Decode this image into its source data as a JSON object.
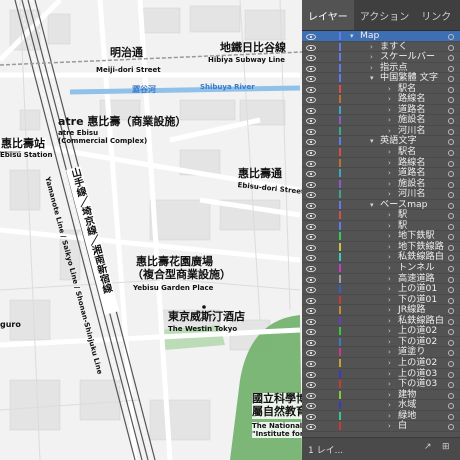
{
  "panel": {
    "tabs": [
      {
        "label": "レイヤー",
        "active": true
      },
      {
        "label": "アクション",
        "active": false
      },
      {
        "label": "リンク",
        "active": false
      }
    ],
    "footer": {
      "layer_count": "1 レイ..."
    },
    "layers": [
      {
        "name": "Map",
        "depth": 0,
        "color": "#5c7cf0",
        "selected": true
      },
      {
        "name": "ますく",
        "depth": 1,
        "color": "#5c7cf0"
      },
      {
        "name": "スケールバー",
        "depth": 1,
        "color": "#5c7cf0"
      },
      {
        "name": "指示点",
        "depth": 1,
        "color": "#5c7cf0"
      },
      {
        "name": "中国繁體 文字",
        "depth": 1,
        "color": "#5c7cf0"
      },
      {
        "name": "駅名",
        "depth": 2,
        "color": "#d94c4c"
      },
      {
        "name": "路線名",
        "depth": 2,
        "color": "#c07030"
      },
      {
        "name": "道路名",
        "depth": 2,
        "color": "#3aa8c8"
      },
      {
        "name": "施設名",
        "depth": 2,
        "color": "#8a5cc8"
      },
      {
        "name": "河川名",
        "depth": 2,
        "color": "#3aa88a"
      },
      {
        "name": "英語文字",
        "depth": 1,
        "color": "#5c7cf0"
      },
      {
        "name": "駅名",
        "depth": 2,
        "color": "#d94c4c"
      },
      {
        "name": "路線名",
        "depth": 2,
        "color": "#c07030"
      },
      {
        "name": "道路名",
        "depth": 2,
        "color": "#3aa8c8"
      },
      {
        "name": "施設名",
        "depth": 2,
        "color": "#8a5cc8"
      },
      {
        "name": "河川名",
        "depth": 2,
        "color": "#3aa88a"
      },
      {
        "name": "ベースmap",
        "depth": 1,
        "color": "#5c7cf0"
      },
      {
        "name": "駅",
        "depth": 2,
        "color": "#d94c4c"
      },
      {
        "name": "駅",
        "depth": 2,
        "color": "#5c7cf0"
      },
      {
        "name": "地下鉄駅",
        "depth": 2,
        "color": "#3ac85c"
      },
      {
        "name": "地下鉄線路",
        "depth": 2,
        "color": "#c8c83a"
      },
      {
        "name": "私鉄線路白",
        "depth": 2,
        "color": "#3ac8c8"
      },
      {
        "name": "トンネル",
        "depth": 2,
        "color": "#c83ac8"
      },
      {
        "name": "高速道路",
        "depth": 2,
        "color": "#a0a0a0"
      },
      {
        "name": "上の道01",
        "depth": 2,
        "color": "#3a5cc8"
      },
      {
        "name": "下の道01",
        "depth": 2,
        "color": "#c83a3a"
      },
      {
        "name": "JR線路",
        "depth": 2,
        "color": "#c8883a"
      },
      {
        "name": "私鉄線路白",
        "depth": 2,
        "color": "#6a3ac8"
      },
      {
        "name": "上の道02",
        "depth": 2,
        "color": "#3ac83a"
      },
      {
        "name": "下の道02",
        "depth": 2,
        "color": "#3a7ac8"
      },
      {
        "name": "道塗り",
        "depth": 2,
        "color": "#c83a8a"
      },
      {
        "name": "上の道02",
        "depth": 2,
        "color": "#c8a03a"
      },
      {
        "name": "上の道03",
        "depth": 2,
        "color": "#3a3ac8"
      },
      {
        "name": "下の道03",
        "depth": 2,
        "color": "#c83a3a"
      },
      {
        "name": "建物",
        "depth": 2,
        "color": "#8ac83a"
      },
      {
        "name": "水域",
        "depth": 2,
        "color": "#3a3ac8"
      },
      {
        "name": "緑地",
        "depth": 2,
        "color": "#3ac88a"
      },
      {
        "name": "白",
        "depth": 2,
        "color": "#c83a3a"
      }
    ]
  },
  "map": {
    "labels": {
      "meiji_jp": "明治通",
      "meiji_en": "Meiji-dori Street",
      "hibiya_jp": "地鐵日比谷線",
      "hibiya_en": "Hibiya Subway Line",
      "shibuya_river_jp": "澀谷河",
      "shibuya_river_en": "Shibuya River",
      "atre_jp": "atre 惠比壽（商業設施）",
      "atre_en1": "atre Ebisu",
      "atre_en2": "(Commercial Complex)",
      "ebisu_station_jp": "惠比壽站",
      "ebisu_station_en": "Ebisu Station",
      "ebisu_dori_jp": "惠比壽通",
      "ebisu_dori_en": "Ebisu-dori Street",
      "yamanote_jp": "山手線／埼京線／湘南新宿線",
      "yamanote_en": "Yamanote Line / Saikyo Line / Shonan-Shinjuku Line",
      "garden_jp1": "惠比壽花園廣場",
      "garden_jp2": "（複合型商業設施）",
      "garden_en": "Yebisu Garden Place",
      "westin_jp": "東京威斯汀酒店",
      "westin_en": "The Westin Tokyo",
      "museum_jp1": "國立科學博",
      "museum_jp2": "屬自然教育",
      "museum_en1": "The National Mu",
      "museum_en2": "\"Institute for Na",
      "guro": "guro"
    }
  }
}
